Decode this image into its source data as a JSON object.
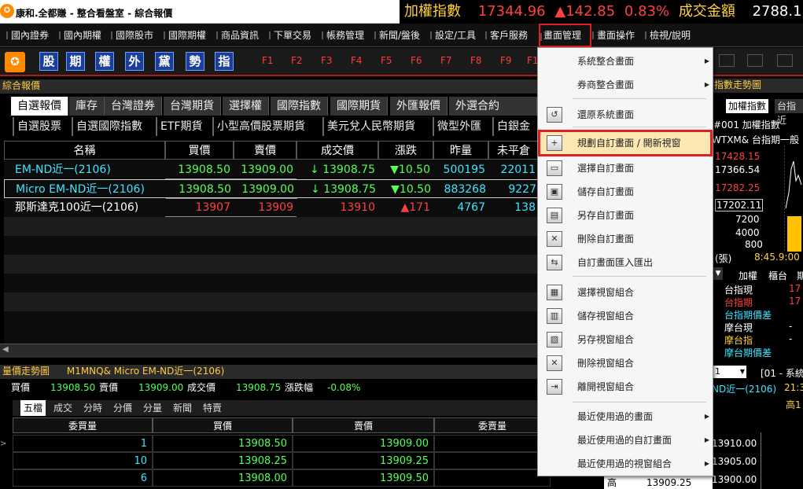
{
  "window": {
    "title": "康和.全都賺 - 整合看盤室 - 綜合報價"
  },
  "ticker": {
    "index_label": "加權指數",
    "index_value": "17344.96",
    "change": "▲142.85",
    "pct": "0.83%",
    "volume_label": "成交金額",
    "volume_value": "2788.11"
  },
  "menubar": [
    "國內證券",
    "國內期權",
    "國際股市",
    "國際期權",
    "商品資訊",
    "下單交易",
    "帳務管理",
    "新聞/盤後",
    "設定/工具",
    "客戶服務",
    "畫面管理",
    "畫面操作",
    "檢視/說明"
  ],
  "toolbar": {
    "brand": "CONCORD",
    "quick": [
      "股",
      "期",
      "權",
      "外",
      "黛",
      "勢",
      "指"
    ],
    "fkeys": [
      "F1",
      "F2",
      "F3",
      "F4",
      "F5",
      "F6",
      "F7",
      "F8",
      "F9",
      "F1"
    ]
  },
  "left_panel": {
    "title": "綜合報價"
  },
  "tabs_primary": [
    "自選報價",
    "庫存",
    "台灣證券",
    "台灣期貨",
    "選擇權",
    "國際指數",
    "國際期貨",
    "外匯報價",
    "外選合約"
  ],
  "tabs_secondary": [
    "自選股票",
    "自選國際指數",
    "ETF期貨",
    "小型高價股票期貨",
    "美元兌人民幣期貨",
    "微型外匯",
    "白銀金"
  ],
  "quote_table": {
    "headers": [
      "名稱",
      "買價",
      "賣價",
      "成交價",
      "漲跌",
      "昨量",
      "未平倉"
    ],
    "rows": [
      {
        "name": "EM-ND近一(2106)",
        "bid": "13908.50",
        "ask": "13909.00",
        "last": "↓ 13908.75",
        "chg": "▼10.50",
        "vol": "500195",
        "oi": "22011"
      },
      {
        "name": "Micro EM-ND近一(2106)",
        "bid": "13908.50",
        "ask": "13909.00",
        "last": "↓ 13908.75",
        "chg": "▼10.50",
        "vol": "883268",
        "oi": "9227"
      },
      {
        "name": "那斯達克100近一(2106)",
        "bid": "13907",
        "ask": "13909",
        "last": "13910",
        "chg": "▲171",
        "vol": "4767",
        "oi": "138"
      }
    ]
  },
  "bottom": {
    "title": "量價走勢圖",
    "symbol": "M1MNQ&  Micro EM-ND近一(2106)",
    "info": [
      {
        "k": "買價",
        "v": "13908.50"
      },
      {
        "k": "賣價",
        "v": "13909.00"
      },
      {
        "k": "成交價",
        "v": "13908.75"
      },
      {
        "k": "漲跌幅",
        "v": "-0.08%"
      }
    ],
    "subtabs": [
      "五檔",
      "成交",
      "分時",
      "分價",
      "分量",
      "新聞",
      "特賣"
    ],
    "orderbook_headers": [
      "委買量",
      "買價",
      "賣價",
      "委賣量"
    ],
    "orderbook": [
      {
        "bq": "1",
        "bid": "13908.50",
        "ask": "13909.00"
      },
      {
        "bq": "10",
        "bid": "13908.25",
        "ask": "13909.25"
      },
      {
        "bq": "6",
        "bid": "13908.00",
        "ask": "13909.50"
      }
    ]
  },
  "right_panel": {
    "title": "指數走勢圖",
    "tabs": [
      "加權指數",
      "台指近"
    ],
    "code": "#001 加權指數",
    "code2": "WTXM& 台指期一般",
    "prices": [
      "17428.15",
      "17366.54",
      "17282.25",
      "17202.11"
    ],
    "vols": [
      "7200",
      "4000",
      "800"
    ],
    "unit": "(張)",
    "time": "8:45.9:00",
    "sub_tabs": [
      "加權",
      "櫃台",
      "期"
    ],
    "list": [
      "台指現",
      "台指期",
      "台指期價差",
      "摩台現",
      "摩台指",
      "摩台期價差"
    ],
    "list_vals": [
      "17",
      "17",
      "",
      "-",
      "-",
      ""
    ],
    "select": "1",
    "select_label": "[01 - 系統",
    "name2": "ND近一(2106)",
    "time2": "21:3",
    "high_label": "高1",
    "levels": [
      "13910.00",
      "13905.00",
      "13900.00"
    ],
    "bottom_label": "高",
    "bottom_val": "13909.25"
  },
  "dropdown": {
    "items": [
      {
        "label": "系統整合畫面",
        "icon": "",
        "arrow": true
      },
      {
        "label": "券商整合畫面",
        "icon": "",
        "arrow": true
      },
      {
        "label": "還原系統畫面",
        "icon": "restore-icon",
        "arrow": false
      },
      {
        "label": "規劃自訂畫面 / 開新視窗",
        "icon": "plus-window-icon",
        "arrow": false
      },
      {
        "label": "選擇自訂畫面",
        "icon": "window-select-icon",
        "arrow": false
      },
      {
        "label": "儲存自訂畫面",
        "icon": "save-icon",
        "arrow": false
      },
      {
        "label": "另存自訂畫面",
        "icon": "save-as-icon",
        "arrow": false
      },
      {
        "label": "刪除自訂畫面",
        "icon": "delete-icon",
        "arrow": false
      },
      {
        "label": "自訂畫面匯入匯出",
        "icon": "import-export-icon",
        "arrow": false
      },
      {
        "label": "選擇視窗組合",
        "icon": "layout-select-icon",
        "arrow": false
      },
      {
        "label": "儲存視窗組合",
        "icon": "layout-save-icon",
        "arrow": false
      },
      {
        "label": "另存視窗組合",
        "icon": "layout-save-as-icon",
        "arrow": false
      },
      {
        "label": "刪除視窗組合",
        "icon": "layout-delete-icon",
        "arrow": false
      },
      {
        "label": "離開視窗組合",
        "icon": "layout-exit-icon",
        "arrow": false
      },
      {
        "label": "最近使用過的畫面",
        "icon": "",
        "arrow": true
      },
      {
        "label": "最近使用過的自訂畫面",
        "icon": "",
        "arrow": true
      },
      {
        "label": "最近使用過的視窗組合",
        "icon": "",
        "arrow": true
      }
    ]
  }
}
